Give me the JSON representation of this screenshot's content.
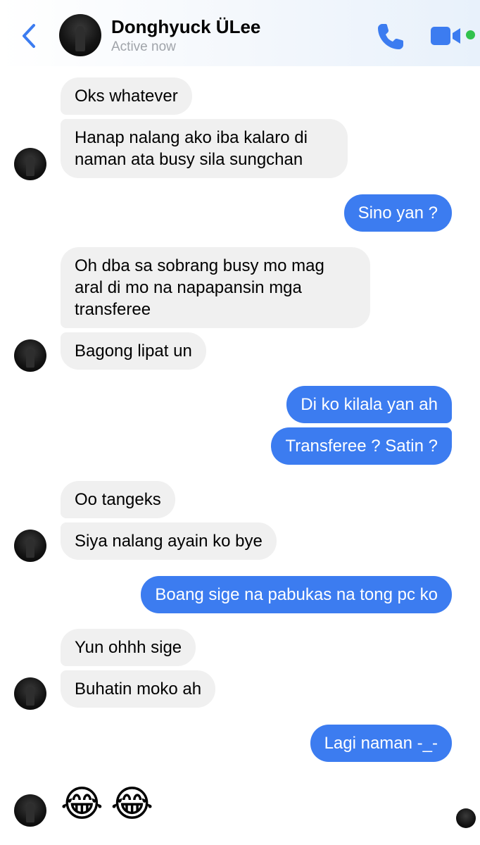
{
  "header": {
    "contact_name": "Donghyuck ÜLee",
    "status": "Active now",
    "icons": {
      "back": "chevron-left-icon",
      "call": "phone-icon",
      "video": "video-camera-icon"
    },
    "accent_color": "#3c7cf0",
    "active_color": "#31c24d"
  },
  "messages": [
    {
      "from": "contact",
      "text": "Oks whatever"
    },
    {
      "from": "contact",
      "text": "Hanap nalang ako iba kalaro di naman ata busy sila sungchan"
    },
    {
      "from": "me",
      "text": "Sino yan ?"
    },
    {
      "from": "contact",
      "text": "Oh dba sa sobrang busy mo mag aral di mo na napapansin mga transferee"
    },
    {
      "from": "contact",
      "text": "Bagong lipat un"
    },
    {
      "from": "me",
      "text": "Di ko kilala yan ah"
    },
    {
      "from": "me",
      "text": "Transferee ? Satin ?"
    },
    {
      "from": "contact",
      "text": "Oo tangeks"
    },
    {
      "from": "contact",
      "text": "Siya nalang ayain ko bye"
    },
    {
      "from": "me",
      "text": "Boang sige na pabukas na tong pc ko"
    },
    {
      "from": "contact",
      "text": "Yun ohhh sige"
    },
    {
      "from": "contact",
      "text": "Buhatin moko ah"
    },
    {
      "from": "me",
      "text": "Lagi naman -_-"
    },
    {
      "from": "contact",
      "text": "😂😂",
      "emoji": [
        "😂",
        "😂"
      ]
    }
  ],
  "colors": {
    "incoming_bubble": "#f0f0f0",
    "outgoing_bubble": "#3c7cf0"
  }
}
